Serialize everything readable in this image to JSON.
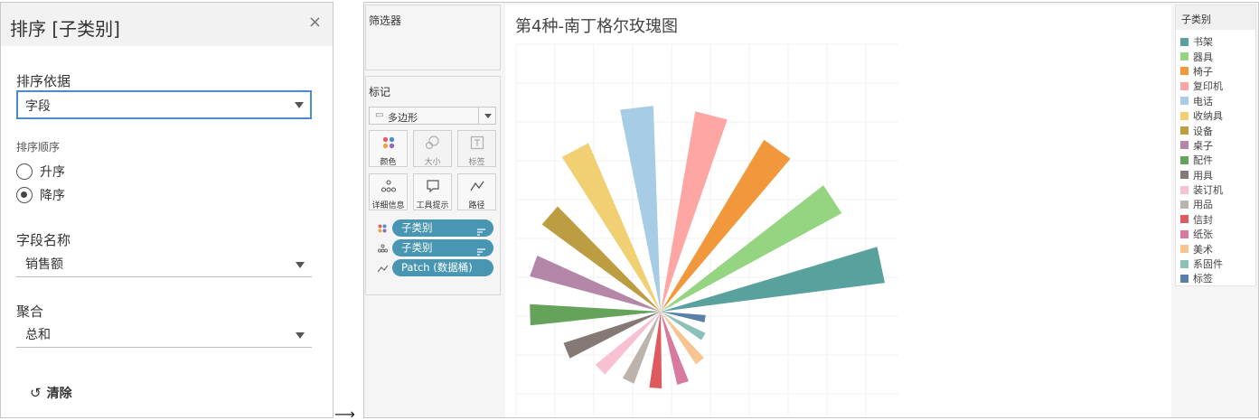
{
  "sort_dialog": {
    "title": "排序 [子类别]",
    "close_glyph": "×",
    "sort_by_label": "排序依据",
    "sort_by_value": "字段",
    "sort_order_label": "排序顺序",
    "ascending_label": "升序",
    "descending_label": "降序",
    "selected_order": "descending",
    "field_name_label": "字段名称",
    "field_name_value": "销售额",
    "aggregation_label": "聚合",
    "aggregation_value": "总和",
    "clear_glyph": "↺",
    "clear_label": "清除"
  },
  "arrow_glyph": "⟶",
  "filters_pane": {
    "title": "筛选器"
  },
  "marks_pane": {
    "title": "标记",
    "mark_type": "多边形",
    "buttons": {
      "color": "颜色",
      "size": "大小",
      "label": "标签",
      "detail": "详细信息",
      "tooltip": "工具提示",
      "path": "路径"
    },
    "pills": [
      {
        "field": "子类别",
        "role": "color"
      },
      {
        "field": "子类别",
        "role": "detail"
      },
      {
        "field": "Patch (数据桶)",
        "role": "path"
      }
    ]
  },
  "viz": {
    "title": "第4种-南丁格尔玫瑰图"
  },
  "legend": {
    "title": "子类别",
    "items": [
      {
        "label": "书架",
        "color": "#59a19d"
      },
      {
        "label": "器具",
        "color": "#95d581"
      },
      {
        "label": "椅子",
        "color": "#f2983c"
      },
      {
        "label": "复印机",
        "color": "#fda6a3"
      },
      {
        "label": "电话",
        "color": "#a7cde6"
      },
      {
        "label": "收纳具",
        "color": "#f0d072"
      },
      {
        "label": "设备",
        "color": "#bc9d41"
      },
      {
        "label": "桌子",
        "color": "#b486a8"
      },
      {
        "label": "配件",
        "color": "#66a35a"
      },
      {
        "label": "用具",
        "color": "#857975"
      },
      {
        "label": "装订机",
        "color": "#f7c1d2"
      },
      {
        "label": "用品",
        "color": "#bdb3ad"
      },
      {
        "label": "信封",
        "color": "#dd5a5f"
      },
      {
        "label": "纸张",
        "color": "#d67b9d"
      },
      {
        "label": "美术",
        "color": "#f8c48f"
      },
      {
        "label": "系固件",
        "color": "#8cc1b8"
      },
      {
        "label": "标签",
        "color": "#5a7fa8"
      }
    ]
  },
  "chart_data": {
    "type": "nightingale-rose",
    "title": "第4种-南丁格尔玫瑰图",
    "sort": "descending by 销售额 (sum)",
    "categories": [
      "书架",
      "器具",
      "椅子",
      "复印机",
      "电话",
      "收纳具",
      "设备",
      "桌子",
      "配件",
      "用具",
      "装订机",
      "用品",
      "信封",
      "纸张",
      "美术",
      "系固件",
      "标签"
    ],
    "values": [
      250,
      228,
      222,
      225,
      228,
      203,
      163,
      150,
      145,
      113,
      93,
      85,
      85,
      83,
      70,
      55,
      50
    ],
    "value_scale": "relative radius, unlabeled",
    "grid": true,
    "legend": "right"
  }
}
